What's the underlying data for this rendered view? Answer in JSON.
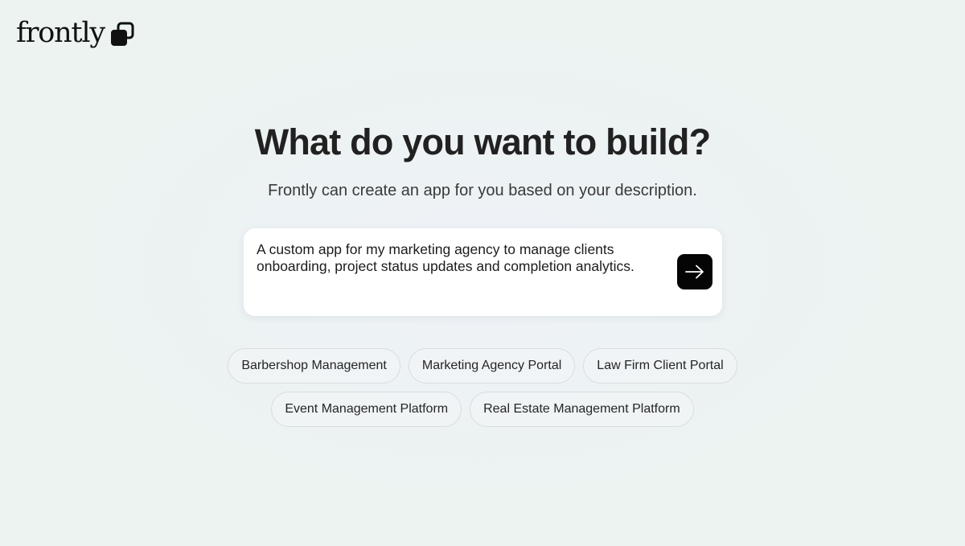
{
  "brand": {
    "name": "frontly",
    "logo_icon": "stacked-squares-icon"
  },
  "hero": {
    "title": "What do you want to build?",
    "subtitle": "Frontly can create an app for you based on your description."
  },
  "prompt": {
    "value": "A custom app for my marketing agency to manage clients onboarding, project status updates and completion analytics.",
    "submit_icon": "arrow-right-icon"
  },
  "suggestions": {
    "row1": [
      "Barbershop Management",
      "Marketing Agency Portal",
      "Law Firm Client Portal"
    ],
    "row2": [
      "Event Management Platform",
      "Real Estate Management Platform"
    ]
  },
  "colors": {
    "background": "#ecf3f1",
    "card": "#ffffff",
    "button": "#050505",
    "text": "#212121"
  }
}
